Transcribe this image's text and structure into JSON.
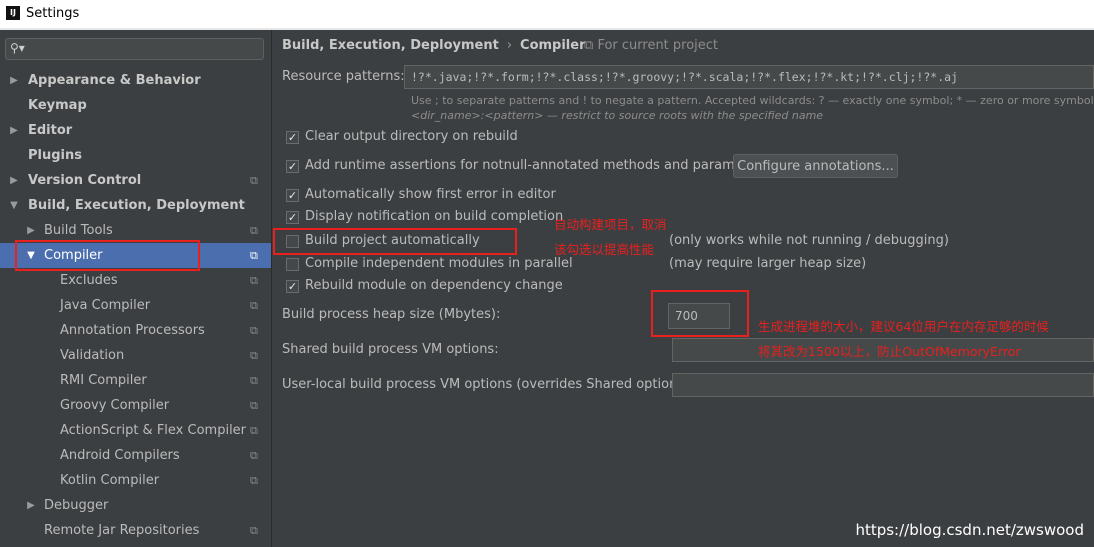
{
  "window": {
    "icon_text": "IJ",
    "title": "Settings"
  },
  "search": {
    "icon": "search-icon"
  },
  "sidebar": {
    "appearance": "Appearance & Behavior",
    "keymap": "Keymap",
    "editor": "Editor",
    "plugins": "Plugins",
    "version_control": "Version Control",
    "build_exec": "Build, Execution, Deployment",
    "build_tools": "Build Tools",
    "compiler": "Compiler",
    "excludes": "Excludes",
    "java_compiler": "Java Compiler",
    "annotation_processors": "Annotation Processors",
    "validation": "Validation",
    "rmi_compiler": "RMI Compiler",
    "groovy_compiler": "Groovy Compiler",
    "actionscript": "ActionScript & Flex Compiler",
    "android": "Android Compilers",
    "kotlin": "Kotlin Compiler",
    "debugger": "Debugger",
    "remote_jar": "Remote Jar Repositories"
  },
  "breadcrumb": {
    "parent": "Build, Execution, Deployment",
    "separator": "›",
    "current": "Compiler",
    "scope": "For current project"
  },
  "resource_patterns": {
    "label": "Resource patterns:",
    "value": "!?*.java;!?*.form;!?*.class;!?*.groovy;!?*.scala;!?*.flex;!?*.kt;!?*.clj;!?*.aj",
    "hint1": "Use ; to separate patterns and ! to negate a pattern. Accepted wildcards: ? — exactly one symbol; * — zero or more symbols; / — pa",
    "hint2": "<dir_name>:<pattern> — restrict to source roots with the specified name"
  },
  "options": {
    "clear_output": {
      "label": "Clear output directory on rebuild",
      "checked": true
    },
    "runtime_assertions": {
      "label": "Add runtime assertions for notnull-annotated methods and parameters",
      "checked": true
    },
    "configure_button": "Configure annotations...",
    "show_first_error": {
      "label": "Automatically show first error in editor",
      "checked": true
    },
    "notify_build": {
      "label": "Display notification on build completion",
      "checked": true
    },
    "build_auto": {
      "label": "Build project automatically",
      "checked": false,
      "note": "(only works while not running / debugging)"
    },
    "compile_parallel": {
      "label": "Compile independent modules in parallel",
      "checked": false,
      "note": "(may require larger heap size)"
    },
    "rebuild_dep": {
      "label": "Rebuild module on dependency change",
      "checked": true
    }
  },
  "heap": {
    "label": "Build process heap size (Mbytes):",
    "value": "700"
  },
  "shared_vm": {
    "label": "Shared build process VM options:",
    "value": ""
  },
  "user_vm": {
    "label": "User-local build process VM options (overrides Shared options):",
    "value": ""
  },
  "annotations": {
    "auto_build_1": "自动构建项目，取消",
    "auto_build_2": "该勾选以提高性能",
    "heap_1": "生成进程堆的大小，建议64位用户在内存足够的时候",
    "heap_2": "将其改为1500以上，防止OutOfMemoryError"
  },
  "watermark": "https://blog.csdn.net/zwswood",
  "colors": {
    "accent": "#e8201e",
    "selection": "#4b6eaf",
    "background": "#3c3f41"
  }
}
